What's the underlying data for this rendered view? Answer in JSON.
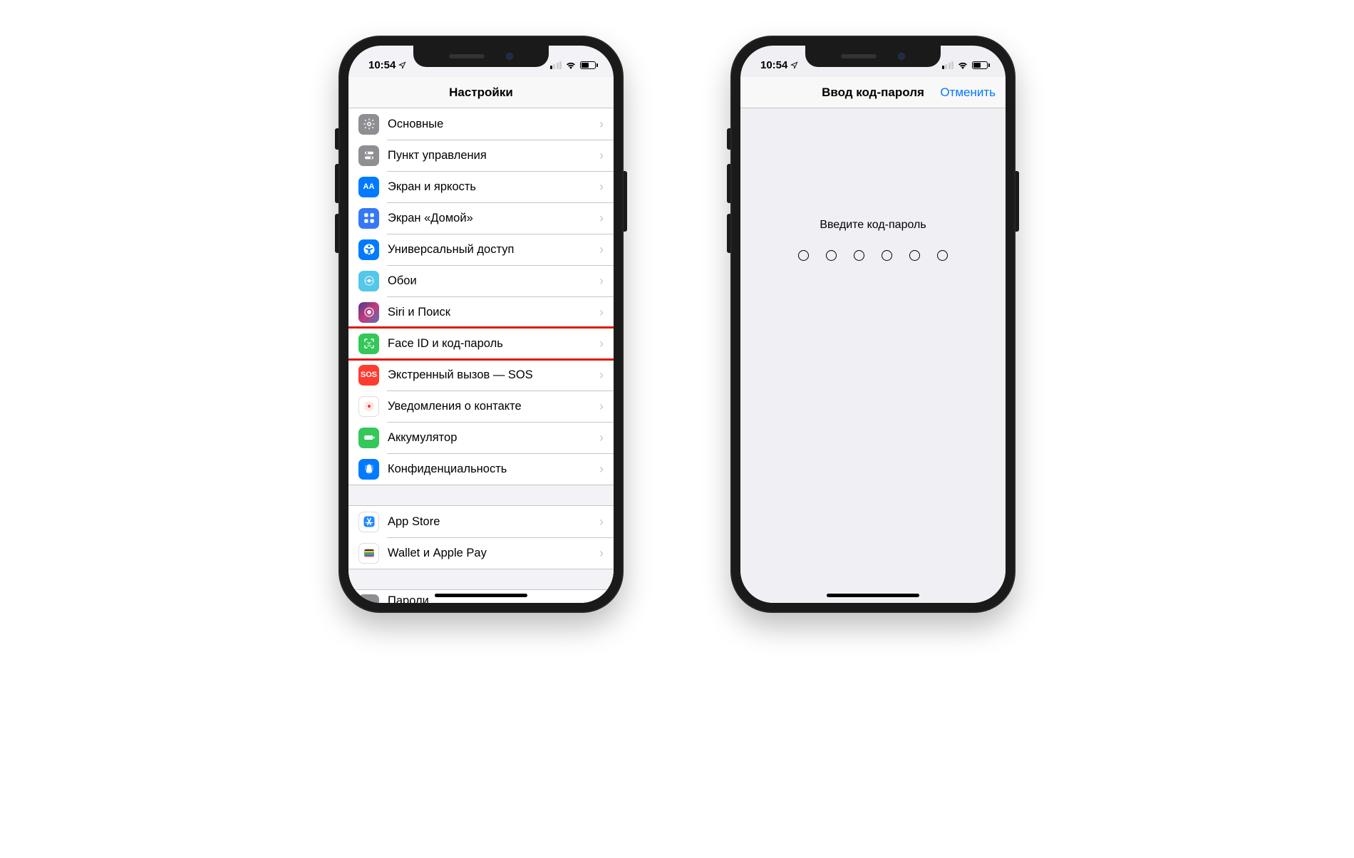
{
  "status": {
    "time": "10:54",
    "location": true
  },
  "phone1": {
    "title": "Настройки",
    "rows_group1": [
      {
        "icon": "gear-icon",
        "icon_class": "ic-gray",
        "label": "Основные"
      },
      {
        "icon": "toggles-icon",
        "icon_class": "ic-gray2",
        "label": "Пункт управления"
      },
      {
        "icon": "text-size-icon",
        "icon_class": "ic-blue",
        "label": "Экран и яркость"
      },
      {
        "icon": "home-grid-icon",
        "icon_class": "ic-blue2",
        "label": "Экран «Домой»"
      },
      {
        "icon": "accessibility-icon",
        "icon_class": "ic-access",
        "label": "Универсальный доступ"
      },
      {
        "icon": "wallpaper-icon",
        "icon_class": "ic-cyan",
        "label": "Обои"
      },
      {
        "icon": "siri-icon",
        "icon_class": "ic-siri",
        "label": "Siri и Поиск"
      },
      {
        "icon": "faceid-icon",
        "icon_class": "ic-green",
        "label": "Face ID и код-пароль",
        "highlighted": true
      },
      {
        "icon": "sos-icon",
        "icon_class": "ic-red",
        "label": "Экстренный вызов — SOS"
      },
      {
        "icon": "exposure-icon",
        "icon_class": "ic-white",
        "label": "Уведомления о контакте"
      },
      {
        "icon": "battery-icon",
        "icon_class": "ic-green2",
        "label": "Аккумулятор"
      },
      {
        "icon": "privacy-icon",
        "icon_class": "ic-hand",
        "label": "Конфиденциальность"
      }
    ],
    "rows_group2": [
      {
        "icon": "appstore-icon",
        "icon_class": "ic-store",
        "label": "App Store"
      },
      {
        "icon": "wallet-icon",
        "icon_class": "ic-wallet",
        "label": "Wallet и Apple Pay"
      }
    ],
    "rows_group3": [
      {
        "icon": "key-icon",
        "icon_class": "ic-key",
        "label": "Пароли"
      }
    ]
  },
  "phone2": {
    "title": "Ввод код-пароля",
    "cancel": "Отменить",
    "prompt": "Введите код-пароль",
    "digits": 6
  }
}
